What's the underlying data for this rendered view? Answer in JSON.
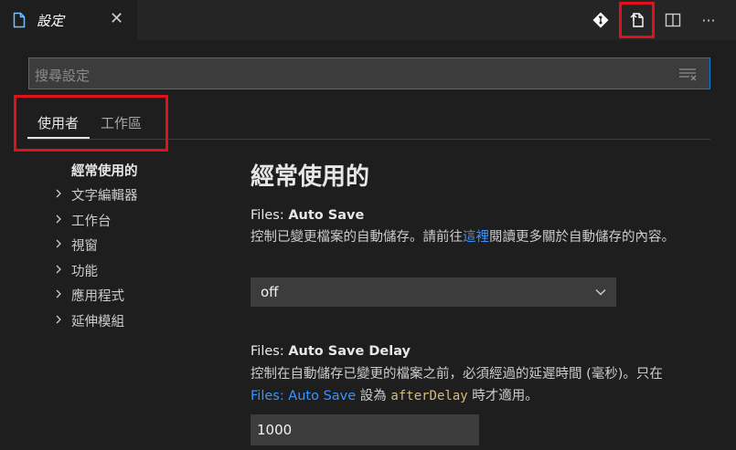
{
  "editor_tab": {
    "label": "設定",
    "icon": "file-icon",
    "close": "✕"
  },
  "actions": [
    {
      "name": "git-icon"
    },
    {
      "name": "open-settings-json-icon"
    },
    {
      "name": "split-editor-icon"
    },
    {
      "name": "more-icon",
      "glyph": "···"
    }
  ],
  "search": {
    "placeholder": "搜尋設定"
  },
  "scope_tabs": [
    {
      "label": "使用者",
      "active": true
    },
    {
      "label": "工作區",
      "active": false
    }
  ],
  "toc": [
    {
      "label": "經常使用的",
      "expandable": false
    },
    {
      "label": "文字編輯器",
      "expandable": true
    },
    {
      "label": "工作台",
      "expandable": true
    },
    {
      "label": "視窗",
      "expandable": true
    },
    {
      "label": "功能",
      "expandable": true
    },
    {
      "label": "應用程式",
      "expandable": true
    },
    {
      "label": "延伸模組",
      "expandable": true
    }
  ],
  "content": {
    "heading": "經常使用的",
    "settings": [
      {
        "category": "Files: ",
        "name": "Auto Save",
        "desc_before": "控制已變更檔案的自動儲存。請前往",
        "desc_link": "這裡",
        "desc_after": "閱讀更多關於自動儲存的內容。",
        "value": "off"
      },
      {
        "category": "Files: ",
        "name": "Auto Save Delay",
        "desc_line1": "控制在自動儲存已變更的檔案之前，必須經過的延遲時間 (毫秒)。只在",
        "desc_link": "Files: Auto Save",
        "desc_mid": " 設為 ",
        "desc_code": "afterDelay",
        "desc_after": " 時才適用。",
        "value": "1000"
      }
    ]
  },
  "colors": {
    "accent": "#007fd4",
    "link": "#3794ff",
    "highlight": "#e0111a"
  }
}
